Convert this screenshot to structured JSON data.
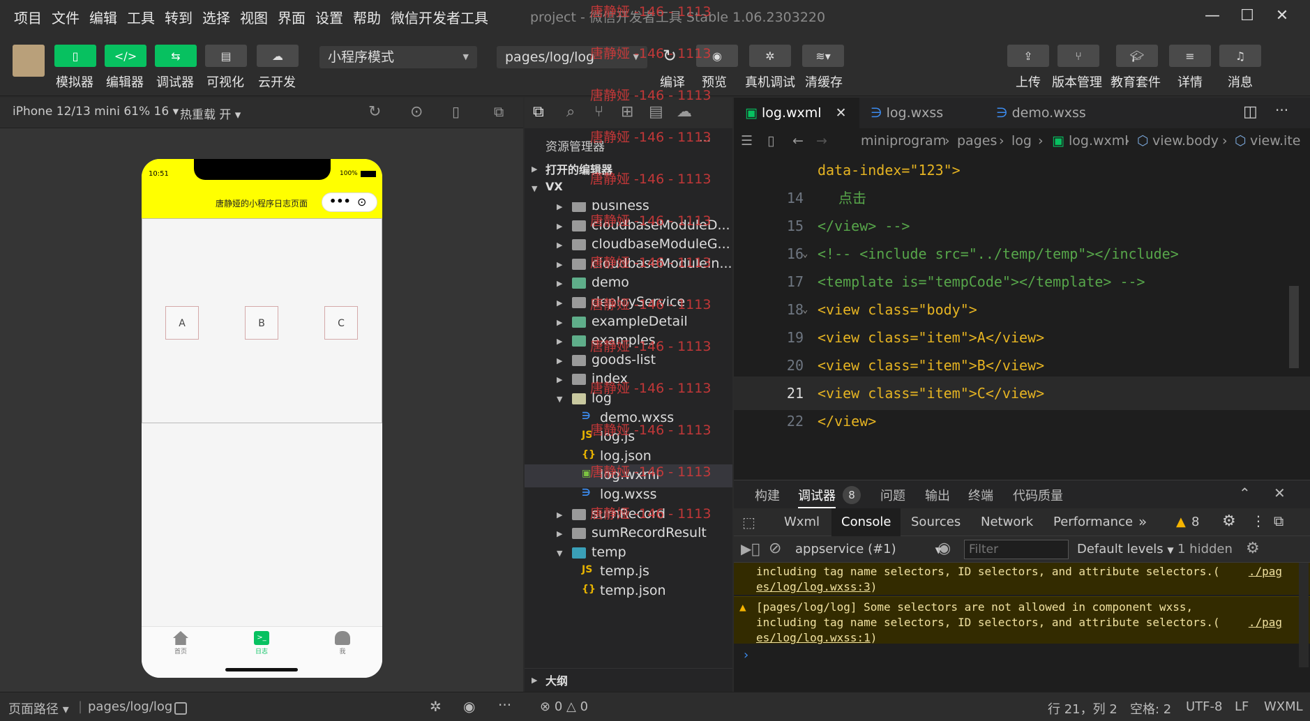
{
  "menu": [
    "项目",
    "文件",
    "编辑",
    "工具",
    "转到",
    "选择",
    "视图",
    "界面",
    "设置",
    "帮助",
    "微信开发者工具"
  ],
  "window_title": "project - 微信开发者工具 Stable 1.06.2303220",
  "toolbar": {
    "left_buttons": [
      {
        "label": "模拟器",
        "icon": "phone-icon"
      },
      {
        "label": "编辑器",
        "icon": "code-icon"
      },
      {
        "label": "调试器",
        "icon": "debug-icon"
      },
      {
        "label": "可视化",
        "icon": "layout-icon"
      },
      {
        "label": "云开发",
        "icon": "cloud-icon"
      }
    ],
    "mode_select": "小程序模式",
    "page_select": "pages/log/log",
    "mid_buttons": [
      {
        "label": "编译",
        "icon": "refresh-icon"
      },
      {
        "label": "预览",
        "icon": "eye-icon"
      },
      {
        "label": "真机调试",
        "icon": "bug-icon"
      },
      {
        "label": "清缓存",
        "icon": "layers-icon"
      }
    ],
    "right_buttons": [
      {
        "label": "上传",
        "icon": "upload-icon"
      },
      {
        "label": "版本管理",
        "icon": "branch-icon"
      },
      {
        "label": "教育套件",
        "icon": "graduation-icon"
      },
      {
        "label": "详情",
        "icon": "menu-icon"
      },
      {
        "label": "消息",
        "icon": "bell-icon"
      }
    ]
  },
  "simulator": {
    "device": "iPhone 12/13 mini 61% 16",
    "hot_reload": "热重载 开",
    "status_time": "10:51",
    "status_battery": "100%",
    "nav_title": "唐静娅的小程序日志页面",
    "items": [
      "A",
      "B",
      "C"
    ],
    "tabbar": [
      {
        "label": "首页",
        "icon": "home-icon"
      },
      {
        "label": "日志",
        "icon": "terminal-icon"
      },
      {
        "label": "我",
        "icon": "user-icon"
      }
    ]
  },
  "explorer": {
    "title": "资源管理器",
    "open_editors": "打开的编辑器",
    "root": "VX",
    "tree": [
      {
        "name": "business",
        "type": "folder",
        "depth": 1,
        "expanded": false
      },
      {
        "name": "cloudbaseModuleD...",
        "type": "folder",
        "depth": 1,
        "expanded": false
      },
      {
        "name": "cloudbaseModuleG...",
        "type": "folder",
        "depth": 1,
        "expanded": false
      },
      {
        "name": "cloudbaseModuleIn...",
        "type": "folder",
        "depth": 1,
        "expanded": false
      },
      {
        "name": "demo",
        "type": "folder-green",
        "depth": 1,
        "expanded": false
      },
      {
        "name": "deployService",
        "type": "folder",
        "depth": 1,
        "expanded": false
      },
      {
        "name": "exampleDetail",
        "type": "folder-green",
        "depth": 1,
        "expanded": false
      },
      {
        "name": "examples",
        "type": "folder-green",
        "depth": 1,
        "expanded": false
      },
      {
        "name": "goods-list",
        "type": "folder",
        "depth": 1,
        "expanded": false
      },
      {
        "name": "index",
        "type": "folder",
        "depth": 1,
        "expanded": false
      },
      {
        "name": "log",
        "type": "folder-open",
        "depth": 1,
        "expanded": true
      },
      {
        "name": "demo.wxss",
        "type": "wxss",
        "depth": 2
      },
      {
        "name": "log.js",
        "type": "js",
        "depth": 2
      },
      {
        "name": "log.json",
        "type": "json",
        "depth": 2
      },
      {
        "name": "log.wxml",
        "type": "wxml",
        "depth": 2,
        "selected": true
      },
      {
        "name": "log.wxss",
        "type": "wxss",
        "depth": 2
      },
      {
        "name": "sumRecord",
        "type": "folder",
        "depth": 1,
        "expanded": false
      },
      {
        "name": "sumRecordResult",
        "type": "folder",
        "depth": 1,
        "expanded": false
      },
      {
        "name": "temp",
        "type": "folder-teal",
        "depth": 1,
        "expanded": true
      },
      {
        "name": "temp.js",
        "type": "js",
        "depth": 2
      },
      {
        "name": "temp.json",
        "type": "json",
        "depth": 2
      }
    ],
    "outline": "大纲"
  },
  "editor": {
    "tabs": [
      {
        "label": "log.wxml",
        "active": true,
        "icon": "wxml-icon"
      },
      {
        "label": "log.wxss",
        "active": false,
        "icon": "wxss-icon"
      },
      {
        "label": "demo.wxss",
        "active": false,
        "icon": "wxss-icon"
      }
    ],
    "breadcrumb": [
      "miniprogram",
      "pages",
      "log",
      "log.wxml",
      "view.body",
      "view.ite"
    ],
    "lines": [
      {
        "num": "",
        "text": "data-index=\"123\">"
      },
      {
        "num": "14",
        "text": "点击"
      },
      {
        "num": "15",
        "text": "</view> -->"
      },
      {
        "num": "16",
        "text": "<!-- <include src=\"../temp/temp\"></include>"
      },
      {
        "num": "17",
        "text": "<template is=\"tempCode\"></template> -->"
      },
      {
        "num": "18",
        "text": "<view class=\"body\">"
      },
      {
        "num": "19",
        "text": "<view class=\"item\">A</view>"
      },
      {
        "num": "20",
        "text": "<view class=\"item\">B</view>"
      },
      {
        "num": "21",
        "text": "<view class=\"item\">C</view>"
      },
      {
        "num": "22",
        "text": "</view>"
      }
    ]
  },
  "devtools": {
    "top_tabs": [
      "构建",
      "调试器",
      "问题",
      "输出",
      "终端",
      "代码质量"
    ],
    "debugger_badge": "8",
    "panel_tabs": [
      "Wxml",
      "Console",
      "Sources",
      "Network",
      "Performance"
    ],
    "warn_count": "8",
    "context": "appservice (#1)",
    "filter_placeholder": "Filter",
    "levels": "Default levels",
    "hidden": "1 hidden",
    "messages": [
      {
        "text": "including tag name selectors, ID selectors, and attribute selectors.(",
        "link": "./pages/log/log.wxss:3",
        "link_a": "./pag",
        "link_b": "es/log/log.wxss",
        "link_c": ":3",
        ")": ")"
      },
      {
        "text": "[pages/log/log] Some selectors are not allowed in component wxss,",
        "text2": "including tag name selectors, ID selectors, and attribute selectors.(",
        "link_a": "./pag",
        "link_b": "es/log/log.wxss",
        "link_c": ":1"
      }
    ]
  },
  "statusbar": {
    "page_path_label": "页面路径",
    "page_path": "pages/log/log",
    "errors": "0",
    "warnings": "0",
    "position": "行 21，列 2",
    "spaces": "空格: 2",
    "encoding": "UTF-8",
    "eol": "LF",
    "lang": "WXML"
  },
  "watermark": "唐静娅 -146 - 1113",
  "colors": {
    "accent": "#07c160",
    "nav_yellow": "#ffff00",
    "warn_bg": "#332b00"
  }
}
